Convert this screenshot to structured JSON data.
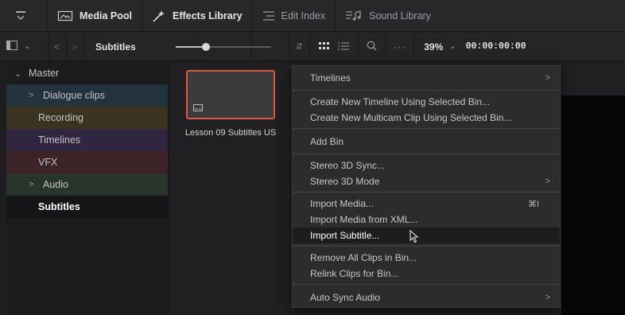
{
  "topbar": {
    "tabs": [
      {
        "label": "Media Pool",
        "icon": "media-pool-icon"
      },
      {
        "label": "Effects Library",
        "icon": "effects-library-icon"
      },
      {
        "label": "Edit Index",
        "icon": "edit-index-icon"
      },
      {
        "label": "Sound Library",
        "icon": "sound-library-icon"
      }
    ]
  },
  "toolbar": {
    "bin_title": "Subtitles",
    "zoom": "39%",
    "timecode": "00:00:00:00"
  },
  "sidebar": {
    "items": [
      {
        "label": "Master",
        "color": "#1c1c1e"
      },
      {
        "label": "Dialogue clips",
        "color": "#22333b"
      },
      {
        "label": "Recording",
        "color": "#3a3320"
      },
      {
        "label": "Timelines",
        "color": "#30263f"
      },
      {
        "label": "VFX",
        "color": "#3b2328"
      },
      {
        "label": "Audio",
        "color": "#28352b"
      },
      {
        "label": "Subtitles",
        "color": "#151517"
      }
    ]
  },
  "clip": {
    "name": "Lesson 09 Subtitles US"
  },
  "context_menu": {
    "items": [
      {
        "label": "Timelines"
      },
      {
        "label": "Create New Timeline Using Selected Bin..."
      },
      {
        "label": "Create New Multicam Clip Using Selected Bin..."
      },
      {
        "label": "Add Bin"
      },
      {
        "label": "Stereo 3D Sync..."
      },
      {
        "label": "Stereo 3D Mode"
      },
      {
        "label": "Import Media...",
        "shortcut": "⌘I"
      },
      {
        "label": "Import Media from XML..."
      },
      {
        "label": "Import Subtitle..."
      },
      {
        "label": "Remove All Clips in Bin..."
      },
      {
        "label": "Relink Clips for Bin..."
      },
      {
        "label": "Auto Sync Audio"
      }
    ]
  },
  "colors": {
    "accent": "#e0583c",
    "menu_bg": "#2c2c2f",
    "highlight": "#1d1d20"
  }
}
